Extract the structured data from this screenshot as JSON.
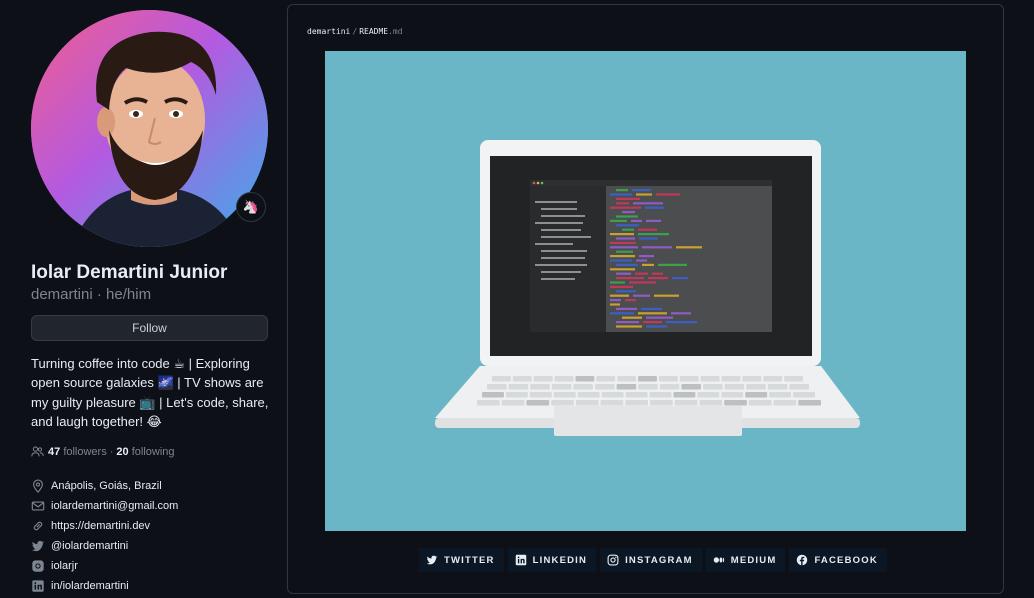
{
  "profile": {
    "name": "Iolar Demartini Junior",
    "login": "demartini",
    "pronouns": "he/him",
    "login_separator": "·",
    "status_emoji": "🦄",
    "follow_label": "Follow",
    "bio": "Turning coffee into code ☕ | Exploring open source galaxies 🌌 | TV shows are my guilty pleasure 📺 | Let's code, share, and laugh together! 😂",
    "followers_count": "47",
    "followers_label": "followers",
    "stats_separator": "·",
    "following_count": "20",
    "following_label": "following",
    "details": [
      {
        "icon": "location-icon",
        "text": "Anápolis, Goiás, Brazil"
      },
      {
        "icon": "mail-icon",
        "text": "iolardemartini@gmail.com"
      },
      {
        "icon": "link-icon",
        "text": "https://demartini.dev"
      },
      {
        "icon": "twitter-icon",
        "text": "@iolardemartini"
      },
      {
        "icon": "instagram-icon",
        "text": "iolarjr"
      },
      {
        "icon": "linkedin-icon",
        "text": "in/iolardemartini"
      }
    ]
  },
  "readme": {
    "owner": "demartini",
    "separator": "/",
    "file_base": "README",
    "file_ext": ".md",
    "banner_bg": "#6bb6c6",
    "social": [
      {
        "icon": "twitter-icon",
        "label": "TWITTER"
      },
      {
        "icon": "linkedin-icon",
        "label": "LINKEDIN"
      },
      {
        "icon": "instagram-icon",
        "label": "INSTAGRAM"
      },
      {
        "icon": "medium-icon",
        "label": "MEDIUM"
      },
      {
        "icon": "facebook-icon",
        "label": "FACEBOOK"
      }
    ]
  },
  "colors": {
    "background": "#0d1117",
    "text": "#e6edf3",
    "muted": "#7d8590",
    "button_bg": "#21262d",
    "badge_bg": "#0c1726"
  }
}
